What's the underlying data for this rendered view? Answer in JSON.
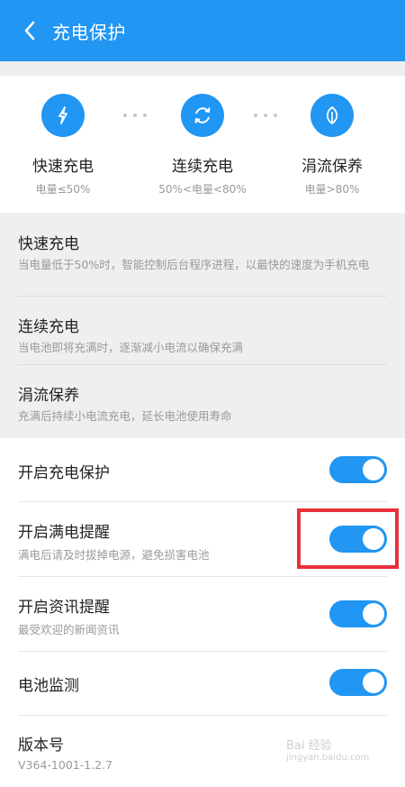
{
  "header": {
    "title": "充电保护",
    "back_icon": "chevron-left-icon"
  },
  "modes": [
    {
      "name": "快速充电",
      "sub": "电量≤50%",
      "icon": "lightning-icon"
    },
    {
      "name": "连续充电",
      "sub": "50%<电量<80%",
      "icon": "refresh-icon"
    },
    {
      "name": "涓流保养",
      "sub": "电量>80%",
      "icon": "leaf-icon"
    }
  ],
  "info": [
    {
      "title": "快速充电",
      "desc": "当电量低于50%时，智能控制后台程序进程，以最快的速度为手机充电"
    },
    {
      "title": "连续充电",
      "desc": "当电池即将充满时，逐渐减小电流以确保充满"
    },
    {
      "title": "涓流保养",
      "desc": "充满后持续小电流充电，延长电池使用寿命"
    }
  ],
  "settings": [
    {
      "title": "开启充电保护",
      "desc": "",
      "on": true
    },
    {
      "title": "开启满电提醒",
      "desc": "满电后请及时拔掉电源，避免损害电池",
      "on": true
    },
    {
      "title": "开启资讯提醒",
      "desc": "最受欢迎的新闻资讯",
      "on": true
    },
    {
      "title": "电池监测",
      "desc": "",
      "on": true
    }
  ],
  "version": {
    "label": "版本号",
    "value": "V364-1001-1.2.7"
  },
  "watermark": {
    "text": "Bai 经验",
    "sub": "jingyan.baidu.com"
  },
  "colors": {
    "primary": "#2196f3",
    "highlight": "#e8303a"
  }
}
